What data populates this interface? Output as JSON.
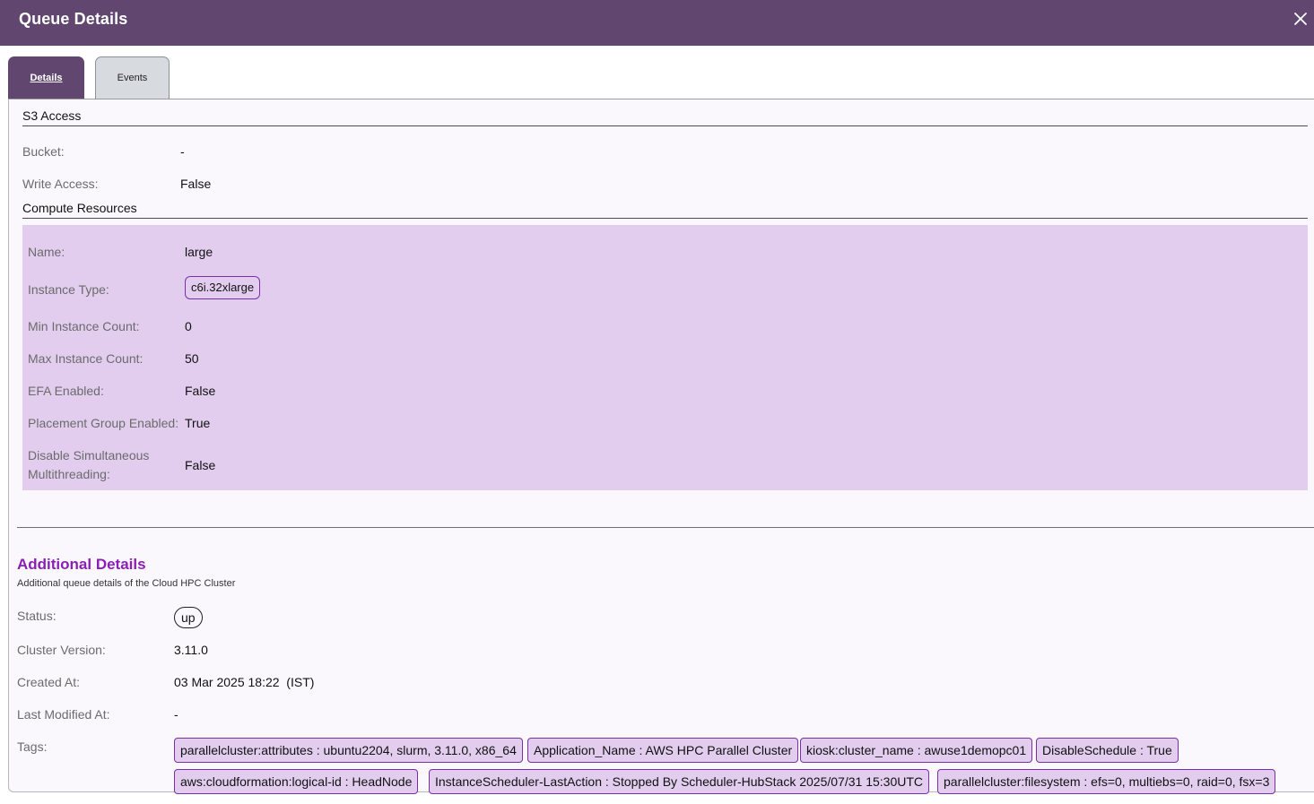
{
  "header": {
    "title": "Queue Details"
  },
  "tabs": [
    {
      "label": "Details",
      "active": true
    },
    {
      "label": "Events",
      "active": false
    }
  ],
  "s3": {
    "heading": "S3 Access",
    "bucket_label": "Bucket:",
    "bucket_value": "-",
    "write_label": "Write Access:",
    "write_value": "False"
  },
  "compute": {
    "heading": "Compute Resources",
    "name_label": "Name:",
    "name_value": "large",
    "instance_type_label": "Instance Type:",
    "instance_type_value": "c6i.32xlarge",
    "min_label": "Min Instance Count:",
    "min_value": "0",
    "max_label": "Max Instance Count:",
    "max_value": "50",
    "efa_label": "EFA Enabled:",
    "efa_value": "False",
    "placement_label": "Placement Group Enabled:",
    "placement_value": "True",
    "smt_label_line1": "Disable Simultaneous",
    "smt_label_line2": "Multithreading:",
    "smt_value": "False"
  },
  "additional": {
    "title": "Additional Details",
    "subtitle": "Additional queue details of the Cloud HPC Cluster",
    "status_label": "Status:",
    "status_value": "up",
    "version_label": "Cluster Version:",
    "version_value": "3.11.0",
    "created_label": "Created At:",
    "created_value": "03 Mar 2025 18:22  (IST)",
    "modified_label": "Last Modified At:",
    "modified_value": "-",
    "tags_label": "Tags:",
    "tags": [
      "parallelcluster:attributes : ubuntu2204, slurm, 3.11.0, x86_64",
      "Application_Name : AWS HPC Parallel Cluster",
      "kiosk:cluster_name : awuse1demopc01",
      "DisableSchedule : True",
      "aws:cloudformation:logical-id : HeadNode",
      "InstanceScheduler-LastAction : Stopped By Scheduler-HubStack 2025/07/31 15:30UTC",
      "parallelcluster:filesystem : efs=0, multiebs=0, raid=0, fsx=3"
    ]
  },
  "colors": {
    "header_bg": "#61476f",
    "compute_bg": "#e2cdef",
    "accent": "#8b1fb5",
    "chip_border": "#7b2fa6"
  }
}
